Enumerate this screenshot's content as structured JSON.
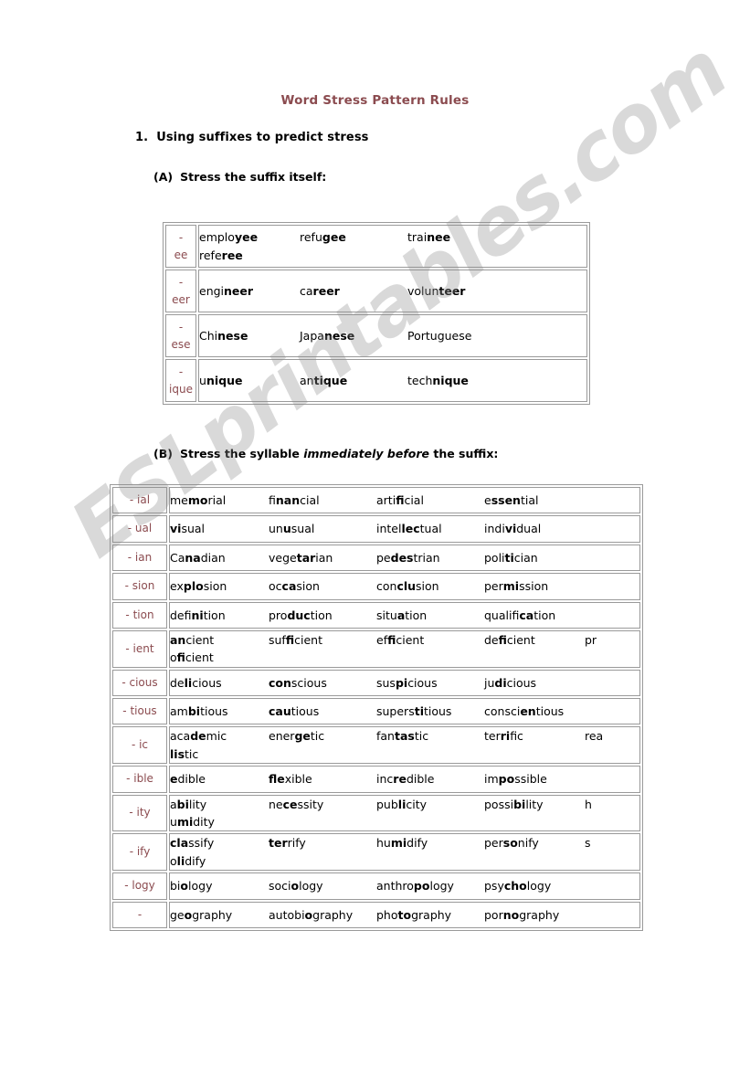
{
  "document": {
    "title": "Word Stress Pattern Rules",
    "title_color": "#8B4B4F",
    "watermark": "ESLprintables.com"
  },
  "rule_1": {
    "number": "1.",
    "text": "Using suffixes to predict stress"
  },
  "section_a": {
    "label": "(A)",
    "heading": "Stress the suffix itself:",
    "rows": [
      {
        "suffix_dash": "-",
        "suffix": "ee",
        "words": [
          {
            "pre": "emplo",
            "stress": "yee",
            "post": ""
          },
          {
            "pre": "refu",
            "stress": "gee",
            "post": ""
          },
          {
            "pre": "trai",
            "stress": "nee",
            "post": ""
          },
          {
            "pre": "refe",
            "stress": "ree",
            "post": ""
          }
        ]
      },
      {
        "suffix_dash": "-",
        "suffix": "eer",
        "words": [
          {
            "pre": "engi",
            "stress": "neer",
            "post": ""
          },
          {
            "pre": "ca",
            "stress": "reer",
            "post": ""
          },
          {
            "pre": "volun",
            "stress": "teer",
            "post": ""
          }
        ]
      },
      {
        "suffix_dash": "-",
        "suffix": "ese",
        "words": [
          {
            "pre": "Chi",
            "stress": "nese",
            "post": ""
          },
          {
            "pre": "Japa",
            "stress": "nese",
            "post": ""
          },
          {
            "pre": "Portuguese",
            "stress": "",
            "post": ""
          }
        ]
      },
      {
        "suffix_dash": "-",
        "suffix": "ique",
        "words": [
          {
            "pre": "u",
            "stress": "nique",
            "post": ""
          },
          {
            "pre": "an",
            "stress": "tique",
            "post": ""
          },
          {
            "pre": "tech",
            "stress": "nique",
            "post": ""
          }
        ]
      }
    ]
  },
  "section_b": {
    "label": "(B)",
    "heading_pre": "Stress the syllable ",
    "heading_em": "immediately before",
    "heading_post": " the suffix:",
    "rows": [
      {
        "suffix": "- ial",
        "words": [
          {
            "pre": "me",
            "stress": "mo",
            "post": "rial"
          },
          {
            "pre": "fi",
            "stress": "nan",
            "post": "cial"
          },
          {
            "pre": "arti",
            "stress": "fi",
            "post": "cial"
          },
          {
            "pre": "e",
            "stress": "ssen",
            "post": "tial"
          }
        ],
        "overflow": ""
      },
      {
        "suffix": "- ual",
        "words": [
          {
            "pre": "",
            "stress": "vi",
            "post": "sual"
          },
          {
            "pre": "un",
            "stress": "u",
            "post": "sual"
          },
          {
            "pre": "intel",
            "stress": "lec",
            "post": "tual"
          },
          {
            "pre": "indi",
            "stress": "vi",
            "post": "dual"
          }
        ],
        "overflow": ""
      },
      {
        "suffix": "- ian",
        "words": [
          {
            "pre": "Ca",
            "stress": "na",
            "post": "dian"
          },
          {
            "pre": "vege",
            "stress": "tar",
            "post": "ian"
          },
          {
            "pre": "pe",
            "stress": "des",
            "post": "trian"
          },
          {
            "pre": "poli",
            "stress": "ti",
            "post": "cian"
          }
        ],
        "overflow": ""
      },
      {
        "suffix": "- sion",
        "words": [
          {
            "pre": "ex",
            "stress": "plo",
            "post": "sion"
          },
          {
            "pre": "oc",
            "stress": "ca",
            "post": "sion"
          },
          {
            "pre": "con",
            "stress": "clu",
            "post": "sion"
          },
          {
            "pre": "per",
            "stress": "mi",
            "post": "ssion"
          }
        ],
        "overflow": ""
      },
      {
        "suffix": "- tion",
        "words": [
          {
            "pre": "defi",
            "stress": "ni",
            "post": "tion"
          },
          {
            "pre": "pro",
            "stress": "duc",
            "post": "tion"
          },
          {
            "pre": "situ",
            "stress": "a",
            "post": "tion"
          },
          {
            "pre": "qualifi",
            "stress": "ca",
            "post": "tion"
          }
        ],
        "overflow": ""
      },
      {
        "suffix": "- ient",
        "words": [
          {
            "pre": "",
            "stress": "an",
            "post": "cient"
          },
          {
            "pre": "suf",
            "stress": "fi",
            "post": "cient"
          },
          {
            "pre": "ef",
            "stress": "fi",
            "post": "cient"
          },
          {
            "pre": "de",
            "stress": "fi",
            "post": "cient"
          }
        ],
        "overflow": "pr",
        "overflow_wrap": [
          {
            "pre": "o",
            "stress": "fi",
            "post": "cient"
          }
        ]
      },
      {
        "suffix": "- cious",
        "words": [
          {
            "pre": "de",
            "stress": "li",
            "post": "cious"
          },
          {
            "pre": "",
            "stress": "con",
            "post": "scious"
          },
          {
            "pre": "sus",
            "stress": "pi",
            "post": "cious"
          },
          {
            "pre": "ju",
            "stress": "di",
            "post": "cious"
          }
        ],
        "overflow": ""
      },
      {
        "suffix": "- tious",
        "words": [
          {
            "pre": "am",
            "stress": "bi",
            "post": "tious"
          },
          {
            "pre": "",
            "stress": "cau",
            "post": "tious"
          },
          {
            "pre": "supers",
            "stress": "ti",
            "post": "tious"
          },
          {
            "pre": "consci",
            "stress": "en",
            "post": "tious"
          }
        ],
        "overflow": ""
      },
      {
        "suffix": "- ic",
        "words": [
          {
            "pre": "aca",
            "stress": "de",
            "post": "mic"
          },
          {
            "pre": "ener",
            "stress": "ge",
            "post": "tic"
          },
          {
            "pre": "fan",
            "stress": "tas",
            "post": "tic"
          },
          {
            "pre": "ter",
            "stress": "ri",
            "post": "fic"
          }
        ],
        "overflow": "rea",
        "overflow_wrap": [
          {
            "pre": "",
            "stress": "lis",
            "post": "tic"
          }
        ]
      },
      {
        "suffix": "- ible",
        "words": [
          {
            "pre": "",
            "stress": "e",
            "post": "dible"
          },
          {
            "pre": "",
            "stress": "fle",
            "post": "xible"
          },
          {
            "pre": "inc",
            "stress": "re",
            "post": "dible"
          },
          {
            "pre": "im",
            "stress": "po",
            "post": "ssible"
          }
        ],
        "overflow": ""
      },
      {
        "suffix": "- ity",
        "words": [
          {
            "pre": "a",
            "stress": "bi",
            "post": "lity"
          },
          {
            "pre": "ne",
            "stress": "ce",
            "post": "ssity"
          },
          {
            "pre": "pub",
            "stress": "li",
            "post": "city"
          },
          {
            "pre": "possi",
            "stress": "bi",
            "post": "lity"
          }
        ],
        "overflow": "h",
        "overflow_wrap": [
          {
            "pre": "u",
            "stress": "mi",
            "post": "dity"
          }
        ]
      },
      {
        "suffix": "- ify",
        "words": [
          {
            "pre": "",
            "stress": "cla",
            "post": "ssify"
          },
          {
            "pre": "",
            "stress": "ter",
            "post": "rify"
          },
          {
            "pre": "hu",
            "stress": "mi",
            "post": "dify"
          },
          {
            "pre": "per",
            "stress": "so",
            "post": "nify"
          }
        ],
        "overflow": "s",
        "overflow_wrap": [
          {
            "pre": "o",
            "stress": "li",
            "post": "dify"
          }
        ]
      },
      {
        "suffix": "- logy",
        "words": [
          {
            "pre": "bi",
            "stress": "o",
            "post": "logy"
          },
          {
            "pre": "soci",
            "stress": "o",
            "post": "logy"
          },
          {
            "pre": "anthro",
            "stress": "po",
            "post": "logy"
          },
          {
            "pre": "psy",
            "stress": "cho",
            "post": "logy"
          }
        ],
        "overflow": ""
      },
      {
        "suffix": "-",
        "words": [
          {
            "pre": "ge",
            "stress": "o",
            "post": "graphy"
          },
          {
            "pre": "autobi",
            "stress": "o",
            "post": "graphy"
          },
          {
            "pre": "pho",
            "stress": "to",
            "post": "graphy"
          },
          {
            "pre": "por",
            "stress": "no",
            "post": "graphy"
          }
        ],
        "overflow": ""
      }
    ]
  }
}
